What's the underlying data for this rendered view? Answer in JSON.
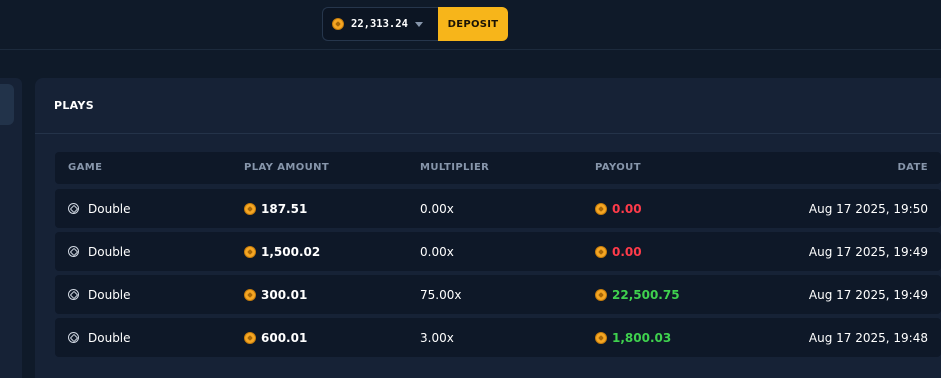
{
  "header": {
    "balance": "22,313.24",
    "deposit_label": "DEPOSIT"
  },
  "plays": {
    "title": "PLAYS",
    "columns": {
      "game": "GAME",
      "play_amount": "PLAY AMOUNT",
      "multiplier": "MULTIPLIER",
      "payout": "PAYOUT",
      "date": "DATE"
    },
    "rows": [
      {
        "game": "Double",
        "play_amount": "187.51",
        "multiplier": "0.00x",
        "payout": "0.00",
        "date": "Aug 17 2025, 19:50",
        "payout_status": "loss"
      },
      {
        "game": "Double",
        "play_amount": "1,500.02",
        "multiplier": "0.00x",
        "payout": "0.00",
        "date": "Aug 17 2025, 19:49",
        "payout_status": "loss"
      },
      {
        "game": "Double",
        "play_amount": "300.01",
        "multiplier": "75.00x",
        "payout": "22,500.75",
        "date": "Aug 17 2025, 19:49",
        "payout_status": "win"
      },
      {
        "game": "Double",
        "play_amount": "600.01",
        "multiplier": "3.00x",
        "payout": "1,800.03",
        "date": "Aug 17 2025, 19:48",
        "payout_status": "win"
      }
    ]
  },
  "colors": {
    "accent": "#f7b51a",
    "loss": "#ff3b4a",
    "win": "#3fd14e",
    "background": "#0f1a29"
  },
  "icons": {
    "currency": "coin-icon",
    "game": "double-game-icon",
    "dropdown": "chevron-down-icon"
  }
}
